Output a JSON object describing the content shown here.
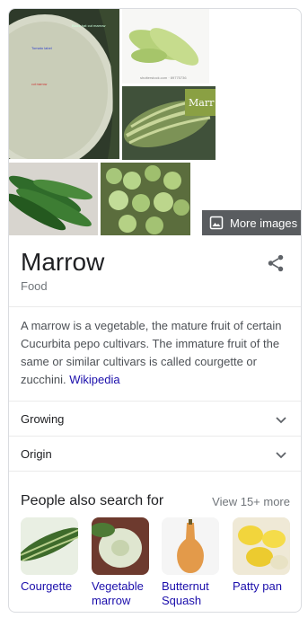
{
  "gallery": {
    "more_images_label": "More images",
    "image_1_text": [
      "Black hat cut marrow",
      "Tomato label",
      "cut marrow"
    ],
    "image_3_watermark": "Marr"
  },
  "entity": {
    "title": "Marrow",
    "subtitle": "Food",
    "description": "A marrow is a vegetable, the mature fruit of certain Cucurbita pepo cultivars. The immature fruit of the same or similar cultivars is called courgette or zucchini.",
    "source_link": "Wikipedia"
  },
  "sections": [
    {
      "label": "Growing"
    },
    {
      "label": "Origin"
    }
  ],
  "people_also_search": {
    "heading": "People also search for",
    "view_more": "View 15+ more",
    "items": [
      {
        "label": "Courgette"
      },
      {
        "label": "Vegetable marrow"
      },
      {
        "label": "Butternut Squash"
      },
      {
        "label": "Patty pan"
      }
    ]
  },
  "colors": {
    "link": "#1a0dab",
    "text": "#202124",
    "muted": "#70757a",
    "border": "#dadce0"
  },
  "icons": [
    "image-icon",
    "share-icon",
    "chevron-down-icon"
  ]
}
